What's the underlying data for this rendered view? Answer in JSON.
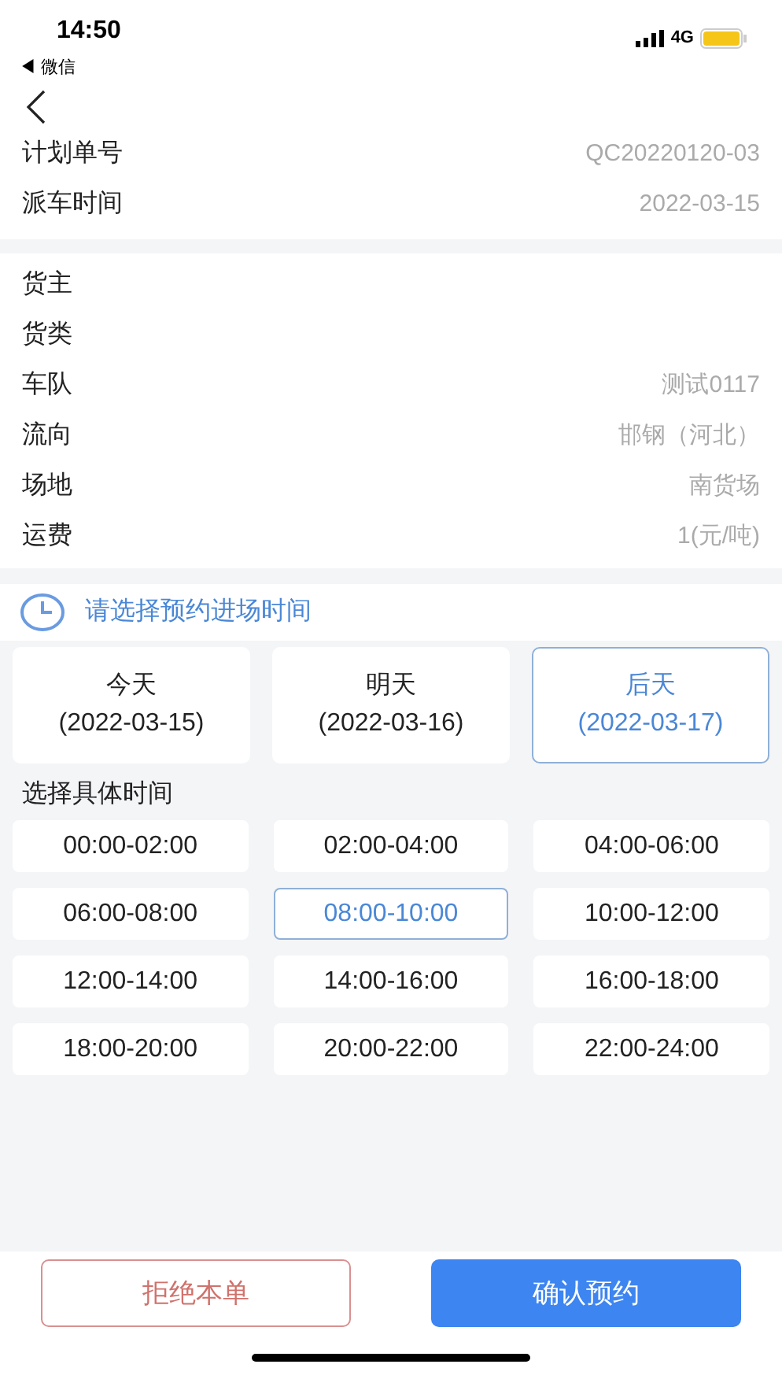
{
  "status_bar": {
    "time": "14:50",
    "back_app": "◀ 微信",
    "network": "4G"
  },
  "plan": [
    {
      "label": "计划单号",
      "value": "QC20220120-03"
    },
    {
      "label": "派车时间",
      "value": "2022-03-15"
    }
  ],
  "details": [
    {
      "label": "货主"
    },
    {
      "label": "货类"
    },
    {
      "label": "车队",
      "value": "测试0117"
    },
    {
      "label": "流向",
      "value": "邯钢（河北）"
    },
    {
      "label": "场地",
      "value": "南货场"
    },
    {
      "label": "运费",
      "value": "1(元/吨)"
    }
  ],
  "prompt": "请选择预约进场时间",
  "days": [
    {
      "name": "今天",
      "date": "(2022-03-15)",
      "selected": false
    },
    {
      "name": "明天",
      "date": "(2022-03-16)",
      "selected": false
    },
    {
      "name": "后天",
      "date": "(2022-03-17)",
      "selected": true
    }
  ],
  "slots_title": "选择具体时间",
  "slots": [
    {
      "label": "00:00-02:00",
      "selected": false
    },
    {
      "label": "02:00-04:00",
      "selected": false
    },
    {
      "label": "04:00-06:00",
      "selected": false
    },
    {
      "label": "06:00-08:00",
      "selected": false
    },
    {
      "label": "08:00-10:00",
      "selected": true
    },
    {
      "label": "10:00-12:00",
      "selected": false
    },
    {
      "label": "12:00-14:00",
      "selected": false
    },
    {
      "label": "14:00-16:00",
      "selected": false
    },
    {
      "label": "16:00-18:00",
      "selected": false
    },
    {
      "label": "18:00-20:00",
      "selected": false
    },
    {
      "label": "20:00-22:00",
      "selected": false
    },
    {
      "label": "22:00-24:00",
      "selected": false
    }
  ],
  "buttons": {
    "reject": "拒绝本单",
    "confirm": "确认预约"
  }
}
